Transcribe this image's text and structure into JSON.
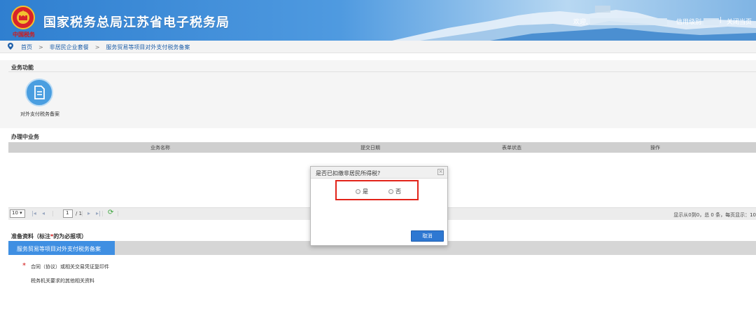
{
  "header": {
    "slogan": "中国税务",
    "title": "国家税务总局江苏省电子税务局",
    "welcome": "欢迎,",
    "credit_label": "信用级别",
    "separator": "|",
    "close_label": "关闭当页"
  },
  "breadcrumb": {
    "home": "首页",
    "sep1": ">",
    "level1": "非居民企业套餐",
    "sep2": ">",
    "level2": "服务贸易等项目对外支付税务备案"
  },
  "functions": {
    "section_title": "业务功能",
    "items": [
      {
        "label": "对外支付税务备案",
        "icon": "document-icon"
      }
    ]
  },
  "in_progress": {
    "section_title": "办理中业务",
    "columns": [
      "业务名称",
      "提交日期",
      "表单状态",
      "操作"
    ],
    "pager": {
      "page_size": "10",
      "page": "1",
      "total_pages": "/ 1",
      "info": "显示从0到0，总 0 条，每页显示：10"
    }
  },
  "materials": {
    "section_title_prefix": "准备资料（标注",
    "section_title_star": "*",
    "section_title_suffix": "的为必报项）",
    "tab_label": "服务贸易等项目对外支付税务备案",
    "items": [
      {
        "required": true,
        "required_mark": "*",
        "label": "合同（协议）或相关交易凭证复印件"
      },
      {
        "required": false,
        "label": "税务机关要求的其他相关资料"
      }
    ]
  },
  "dialog": {
    "title": "是否已扣缴非居民所得税?",
    "close_symbol": "×",
    "option_yes": "是",
    "option_no": "否",
    "cancel_label": "取消"
  },
  "colors": {
    "accent": "#3f8fe2",
    "highlight": "#e2241a",
    "required": "#d01010"
  }
}
